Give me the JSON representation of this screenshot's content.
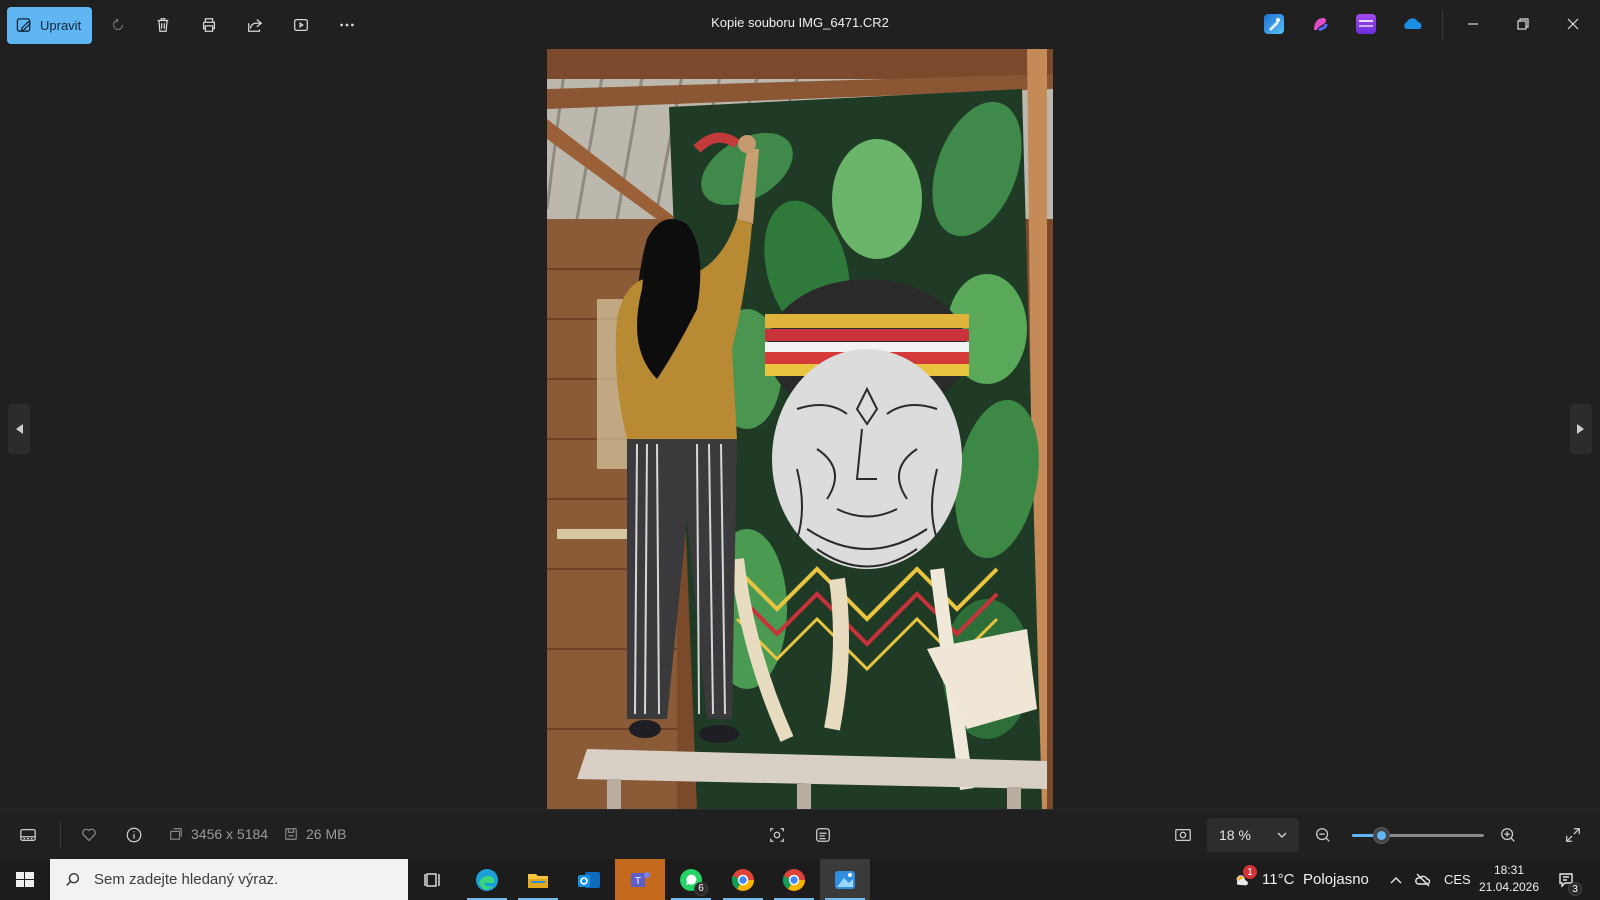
{
  "toolbar": {
    "edit_label": "Upravit",
    "tools": [
      "rotate-icon",
      "delete-icon",
      "print-icon",
      "share-icon",
      "slideshow-icon",
      "more-icon"
    ]
  },
  "window": {
    "title": "Kopie souboru IMG_6471.CR2",
    "apps": [
      "clipchamp-editor-icon",
      "copilot-icon",
      "clipchamp-icon",
      "onedrive-icon"
    ]
  },
  "photo": {
    "subject": "mural-painting-woman-indigenous-face"
  },
  "status": {
    "dimensions": "3456 x 5184",
    "file_size": "26 MB",
    "zoom_value": "18 %",
    "zoom_level": 0.18
  },
  "taskbar": {
    "search_placeholder": "Sem zadejte hledaný výraz.",
    "apps": [
      {
        "name": "task-view",
        "active": false
      },
      {
        "name": "edge",
        "active": false
      },
      {
        "name": "file-explorer",
        "active": false
      },
      {
        "name": "outlook",
        "active": false
      },
      {
        "name": "teams",
        "active": true
      },
      {
        "name": "whatsapp",
        "badge": "6"
      },
      {
        "name": "chrome-profile-1"
      },
      {
        "name": "chrome-profile-2"
      },
      {
        "name": "photos",
        "active": true
      }
    ],
    "weather_temp": "11°C",
    "weather_text": "Polojasno",
    "weather_alert": "1",
    "language": "CES",
    "time": "18:31",
    "date": "21.04.2026",
    "notifications_count": "3"
  },
  "colors": {
    "accent": "#60b6f3",
    "background": "#202020",
    "taskbar": "#1c1c1c"
  }
}
